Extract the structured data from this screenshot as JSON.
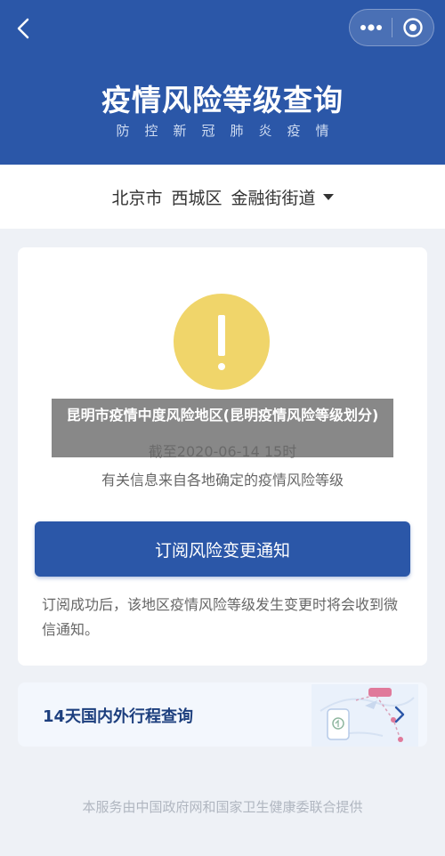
{
  "header": {
    "title": "疫情风险等级查询",
    "subtitle": "防控新冠肺炎疫情",
    "back_icon": "chevron-left-icon",
    "more_icon": "more-dots-icon",
    "close_icon": "target-close-icon",
    "background_color": "#2b57a8"
  },
  "location": {
    "text": "北京市 西城区 金融街街道",
    "dropdown_icon": "caret-down-icon"
  },
  "status_card": {
    "warning_icon": "exclamation-circle-icon",
    "warning_color": "#f0d56a",
    "deadline": "截至2020-06-14 15时",
    "source_note": "有关信息来自各地确定的疫情风险等级",
    "subscribe_button": "订阅风险变更通知",
    "subscribe_tip": "订阅成功后，该地区疫情风险等级发生变更时将会收到微信通知。"
  },
  "trip_card": {
    "title": "14天国内外行程查询",
    "illustration_icon": "map-route-icon",
    "chevron_icon": "chevron-right-icon"
  },
  "footer": {
    "text": "本服务由中国政府网和国家卫生健康委联合提供"
  },
  "overlay": {
    "text": "昆明市疫情中度风险地区(昆明疫情风险等级划分)"
  }
}
